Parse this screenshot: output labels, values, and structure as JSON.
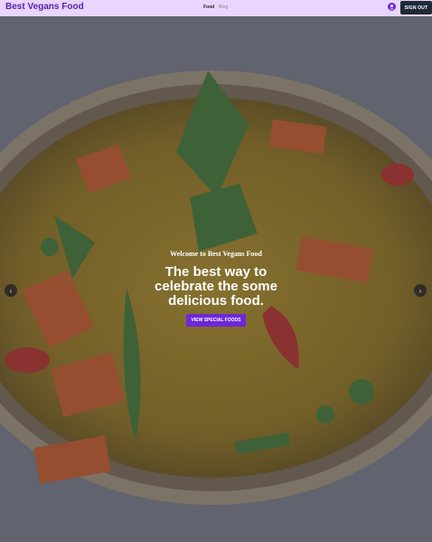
{
  "navbar": {
    "brand": "Best Vegans Food",
    "links": [
      {
        "label": "Food",
        "active": true
      },
      {
        "label": "Blog",
        "active": false
      }
    ],
    "user_icon": "user-circle-icon",
    "signout_label": "SIGN OUT"
  },
  "hero": {
    "welcome": "Welcome to Best Vegans Food",
    "headline_line1": "The best way to",
    "headline_line2": "celebrate the some",
    "headline_line3": "delicious food.",
    "cta_label": "VIEW SPECIAL FOODS",
    "prev_icon": "chevron-left-icon",
    "next_icon": "chevron-right-icon"
  },
  "colors": {
    "navbar_bg": "#e9d5ff",
    "brand": "#5b21b6",
    "cta": "#6d28d9",
    "signout_bg": "#1f2937"
  }
}
